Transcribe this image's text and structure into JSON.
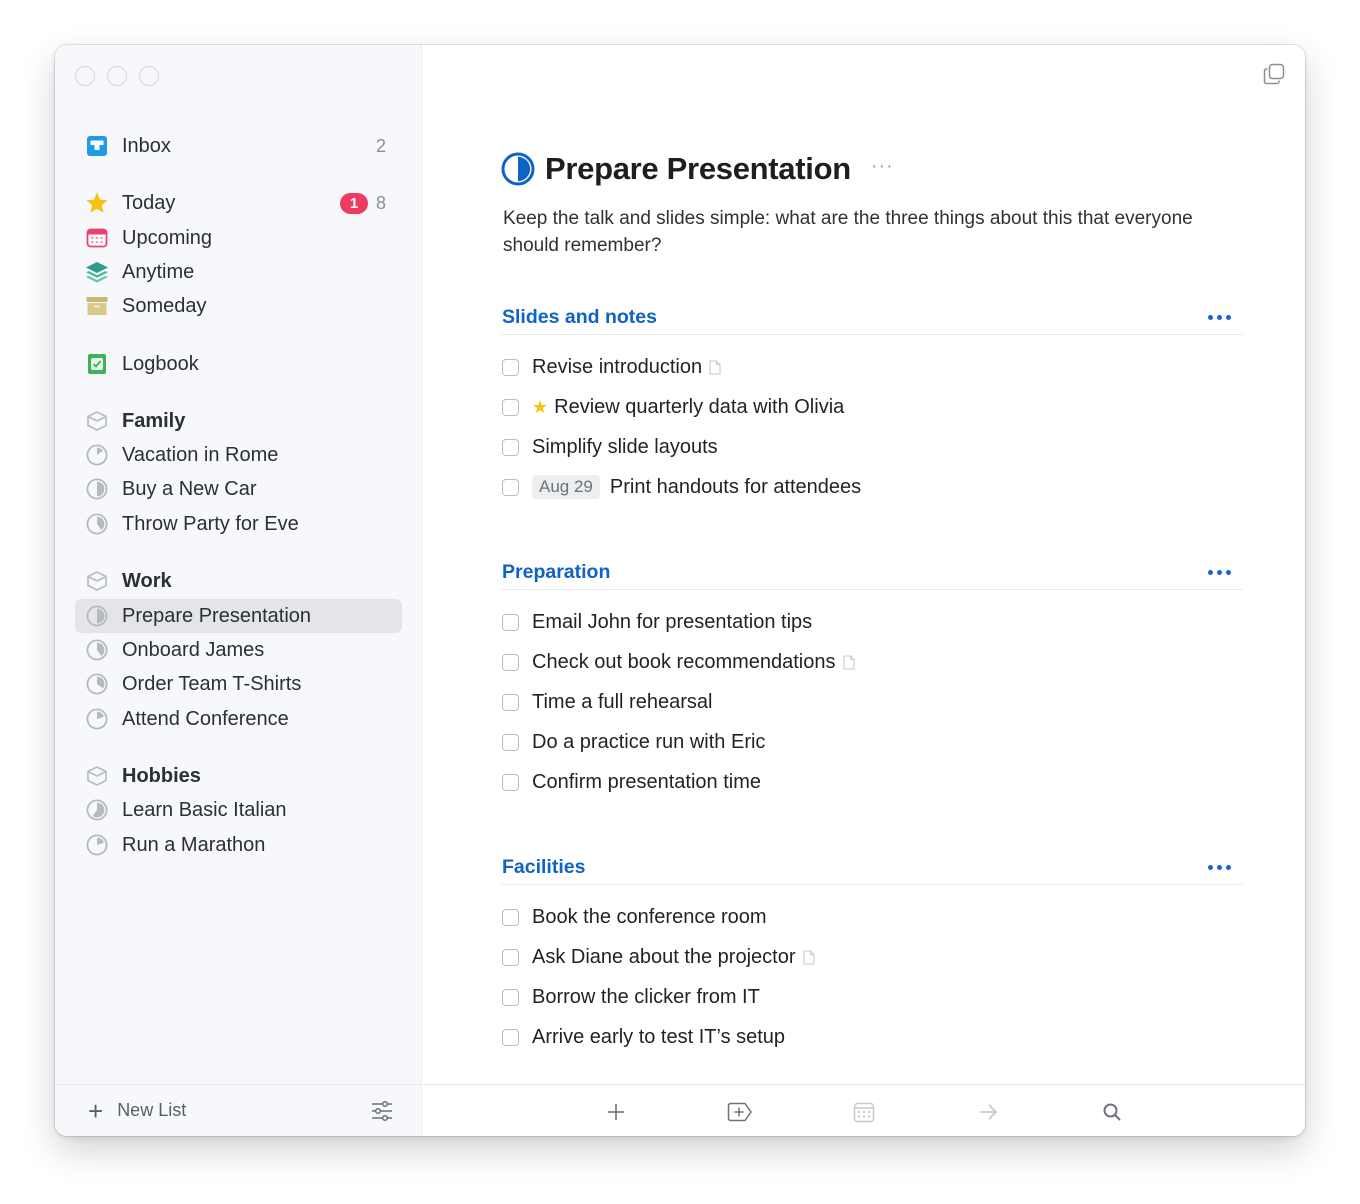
{
  "window": {
    "title": "Prepare Presentation"
  },
  "sidebar": {
    "inbox": {
      "label": "Inbox",
      "count": "2",
      "icon": "inbox-icon"
    },
    "smart_lists": [
      {
        "label": "Today",
        "badge": "1",
        "count": "8",
        "icon": "star-icon"
      },
      {
        "label": "Upcoming",
        "icon": "calendar-icon"
      },
      {
        "label": "Anytime",
        "icon": "layers-icon"
      },
      {
        "label": "Someday",
        "icon": "archive-box-icon"
      }
    ],
    "logbook": {
      "label": "Logbook",
      "icon": "logbook-icon"
    },
    "areas": [
      {
        "label": "Family",
        "projects": [
          {
            "label": "Vacation in Rome",
            "progress": 0.15
          },
          {
            "label": "Buy a New Car",
            "progress": 0.5
          },
          {
            "label": "Throw Party for Eve",
            "progress": 0.4
          }
        ]
      },
      {
        "label": "Work",
        "projects": [
          {
            "label": "Prepare Presentation",
            "progress": 0.5,
            "selected": true
          },
          {
            "label": "Onboard James",
            "progress": 0.4
          },
          {
            "label": "Order Team T-Shirts",
            "progress": 0.35
          },
          {
            "label": "Attend Conference",
            "progress": 0.2
          }
        ]
      },
      {
        "label": "Hobbies",
        "projects": [
          {
            "label": "Learn Basic Italian",
            "progress": 0.6
          },
          {
            "label": "Run a Marathon",
            "progress": 0.2
          }
        ]
      }
    ],
    "footer": {
      "new_list_label": "New List"
    }
  },
  "main": {
    "project_title": "Prepare Presentation",
    "project_progress": 0.5,
    "more_label": "···",
    "notes": "Keep the talk and slides simple: what are the three things about this that everyone should remember?",
    "sections": [
      {
        "title": "Slides and notes",
        "tasks": [
          {
            "label": "Revise introduction",
            "has_note": true
          },
          {
            "label": "Review quarterly data with Olivia",
            "starred": true
          },
          {
            "label": "Simplify slide layouts"
          },
          {
            "label": "Print handouts for attendees",
            "date": "Aug 29"
          }
        ]
      },
      {
        "title": "Preparation",
        "tasks": [
          {
            "label": "Email John for presentation tips"
          },
          {
            "label": "Check out book recommendations",
            "has_note": true
          },
          {
            "label": "Time a full rehearsal"
          },
          {
            "label": "Do a practice run with Eric"
          },
          {
            "label": "Confirm presentation time"
          }
        ]
      },
      {
        "title": "Facilities",
        "tasks": [
          {
            "label": "Book the conference room"
          },
          {
            "label": "Ask Diane about the projector",
            "has_note": true
          },
          {
            "label": "Borrow the clicker from IT"
          },
          {
            "label": "Arrive early to test IT’s setup"
          }
        ]
      }
    ],
    "toolbar": [
      {
        "name": "new-todo-button",
        "icon": "plus-icon"
      },
      {
        "name": "new-heading-button",
        "icon": "add-heading-icon"
      },
      {
        "name": "when-button",
        "icon": "calendar-icon"
      },
      {
        "name": "move-button",
        "icon": "arrow-right-icon"
      },
      {
        "name": "search-button",
        "icon": "search-icon"
      }
    ]
  },
  "colors": {
    "accent": "#0f63c4",
    "badge": "#ef3a62",
    "star": "#f6c20f",
    "inbox": "#1e9be9",
    "upcoming": "#e84370",
    "anytime": "#2f9c8a",
    "someday": "#c9b673",
    "logbook": "#3fb35a"
  }
}
